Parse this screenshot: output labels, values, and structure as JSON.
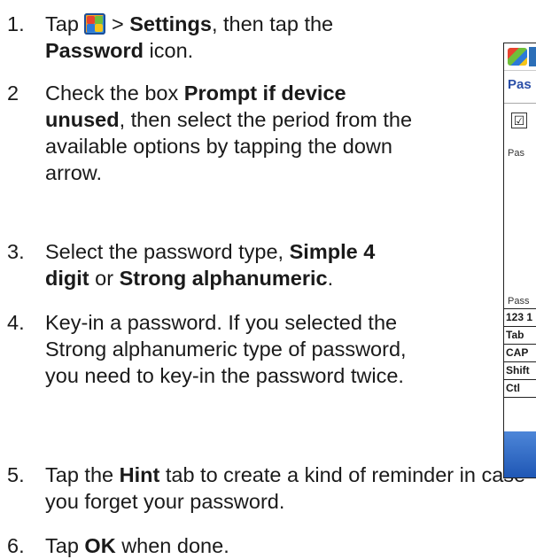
{
  "steps": [
    {
      "num": "1.",
      "t1": "Tap ",
      "t2": " > ",
      "b1": "Settings",
      "t3": ", then tap the ",
      "b2": "Password",
      "t4": " icon."
    },
    {
      "num": "2",
      "t1": "Check the box ",
      "b1": "Prompt if device unused",
      "t2": ", then select the period from the available options by tapping the down arrow."
    },
    {
      "num": "3.",
      "t1": "Select the password type, ",
      "b1": "Simple 4 digit",
      "t2": " or ",
      "b2": "Strong alphanumeric",
      "t3": "."
    },
    {
      "num": "4.",
      "t1": "Key-in a password. If you selected the Strong alphanumeric type of password, you need to key-in the password twice."
    },
    {
      "num": "5.",
      "t1": "Tap the ",
      "b1": "Hint",
      "t2": " tab to create a kind of reminder in case you forget your password."
    },
    {
      "num": "6.",
      "t1": "Tap ",
      "b1": "OK",
      "t2": " when done."
    }
  ],
  "device": {
    "header": "Pas",
    "check_mark": "☑",
    "label_top": "Pas",
    "label_bottom": "Pass",
    "keyboard_rows": [
      "123 1",
      "Tab",
      "CAP",
      "Shift",
      "Ctl"
    ]
  },
  "icons": {
    "start_icon": "windows-start-icon"
  }
}
